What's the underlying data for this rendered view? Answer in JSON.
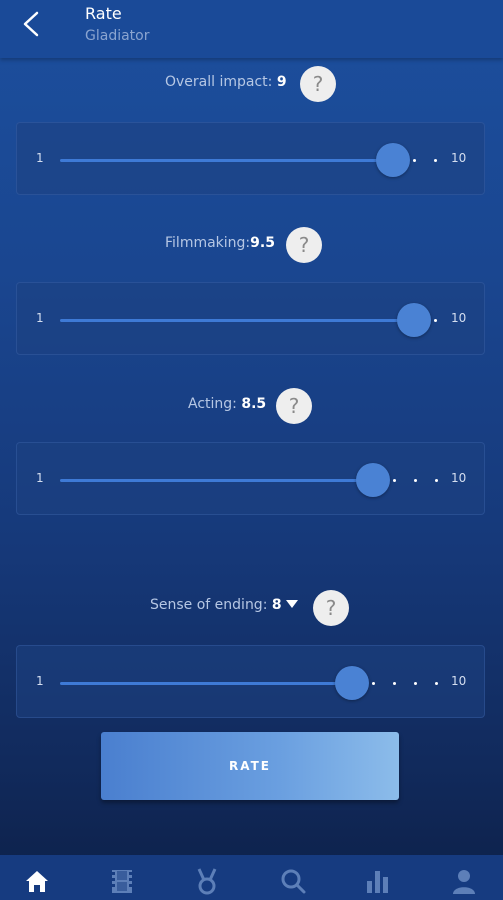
{
  "header": {
    "title": "Rate",
    "subtitle": "Gladiator"
  },
  "ratings": [
    {
      "label": "Overall impact:",
      "value": "9",
      "min_label": "1",
      "max_label": "10",
      "level": 9,
      "min": 1,
      "max": 10
    },
    {
      "label": "Filmmaking:",
      "value": "9.5",
      "min_label": "1",
      "max_label": "10",
      "level": 9.5,
      "min": 1,
      "max": 10
    },
    {
      "label": "Acting:",
      "value": "8.5",
      "min_label": "1",
      "max_label": "10",
      "level": 8.5,
      "min": 1,
      "max": 10
    },
    {
      "label": "Sense of ending:",
      "value": "8",
      "min_label": "1",
      "max_label": "10",
      "level": 8,
      "min": 1,
      "max": 10
    }
  ],
  "help_label": "?",
  "rate_button": "RATE",
  "nav": {
    "items": [
      "home-icon",
      "film-icon",
      "medal-icon",
      "search-icon",
      "bar-chart-icon",
      "profile-icon"
    ],
    "active": "home-icon"
  },
  "colors": {
    "accent": "#4a82d4",
    "track": "#3e7ad6"
  }
}
